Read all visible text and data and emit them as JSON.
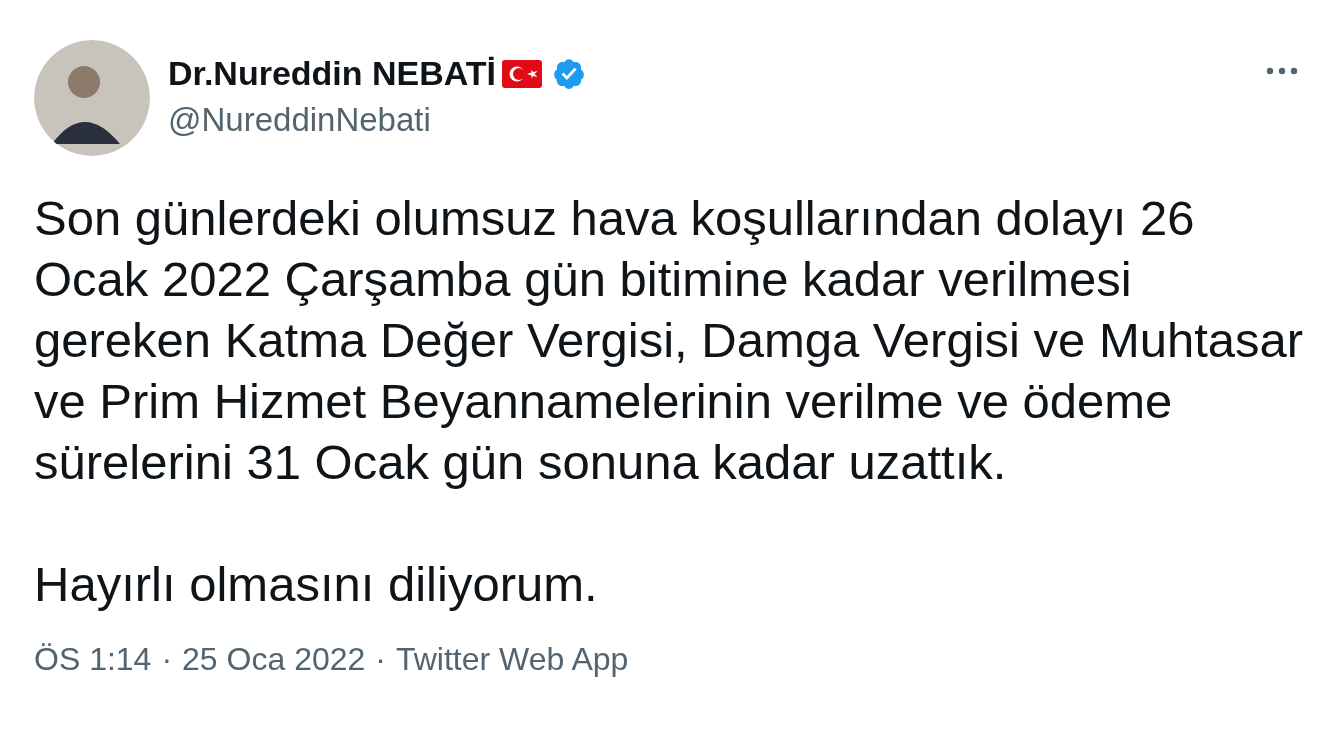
{
  "author": {
    "name": "Dr.Nureddin NEBATİ",
    "handle": "@NureddinNebati",
    "verified": true
  },
  "paragraphs": [
    "Son günlerdeki olumsuz hava koşullarından dolayı 26 Ocak 2022 Çarşamba gün bitimine kadar verilmesi gereken Katma Değer Vergisi, Damga Vergisi ve Muhtasar ve Prim Hizmet Beyannamelerinin verilme ve ödeme sürelerini 31 Ocak gün sonuna kadar uzattık.",
    "Hayırlı olmasını diliyorum."
  ],
  "meta": [
    {
      "kind": "time",
      "text": "ÖS 1:14"
    },
    {
      "kind": "separator",
      "text": "·"
    },
    {
      "kind": "date",
      "text": "25 Oca 2022"
    },
    {
      "kind": "separator",
      "text": "·"
    },
    {
      "kind": "source",
      "text": "Twitter Web App"
    }
  ]
}
